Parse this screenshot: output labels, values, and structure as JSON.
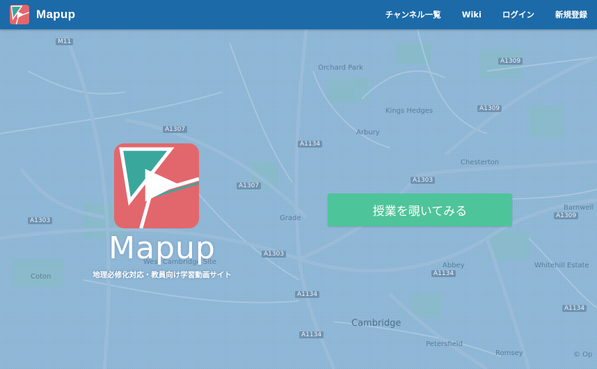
{
  "navbar": {
    "brand_name": "Mapup",
    "links": [
      "チャンネル一覧",
      "Wiki",
      "ログイン",
      "新規登録"
    ]
  },
  "hero": {
    "logo_word": "Mapup",
    "tagline": "地理必修化対応・教員向け学習動画サイト",
    "cta_label": "授業を覗いてみる"
  },
  "map": {
    "places": [
      "Orchard Park",
      "Kings Hedges",
      "Arbury",
      "Chesterton",
      "Barnwell",
      "Coton",
      "Grade",
      "Abbey",
      "Whitehill Estate",
      "Cambridge",
      "Petersfield",
      "Romsey",
      "West Cambridge Site"
    ],
    "roads": [
      "M11",
      "A1307",
      "A1309",
      "A1303",
      "A1134",
      "A1134",
      "A1307",
      "A1309",
      "A1303",
      "A1134",
      "A1303",
      "A1309",
      "A1134",
      "A1134"
    ],
    "attribution": "© Op"
  },
  "colors": {
    "navbar": "#1c6aa8",
    "cta": "#4ec49a",
    "logo_red": "#e2676c",
    "logo_teal": "#3aa79d",
    "map_tint": "#8fb6d6"
  }
}
